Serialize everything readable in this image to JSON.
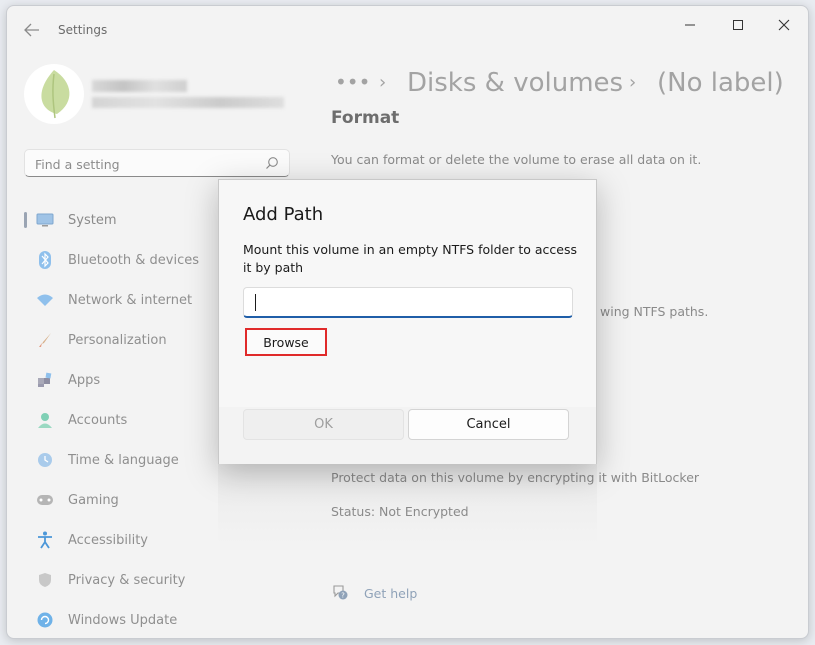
{
  "app": {
    "title": "Settings"
  },
  "search": {
    "placeholder": "Find a setting"
  },
  "sidebar": {
    "items": [
      {
        "label": "System",
        "icon": "monitor-icon"
      },
      {
        "label": "Bluetooth & devices",
        "icon": "bluetooth-icon"
      },
      {
        "label": "Network & internet",
        "icon": "wifi-icon"
      },
      {
        "label": "Personalization",
        "icon": "brush-icon"
      },
      {
        "label": "Apps",
        "icon": "apps-icon"
      },
      {
        "label": "Accounts",
        "icon": "person-icon"
      },
      {
        "label": "Time & language",
        "icon": "clock-globe-icon"
      },
      {
        "label": "Gaming",
        "icon": "gamepad-icon"
      },
      {
        "label": "Accessibility",
        "icon": "accessibility-icon"
      },
      {
        "label": "Privacy & security",
        "icon": "shield-icon"
      },
      {
        "label": "Windows Update",
        "icon": "update-icon"
      }
    ]
  },
  "breadcrumb": {
    "overflow": "•••",
    "parent": "Disks & volumes",
    "current": "(No label)"
  },
  "content": {
    "format_title": "Format",
    "format_desc": "You can format or delete the volume to erase all data on it.",
    "paths_fragment": "wing NTFS paths.",
    "bitlocker_desc": "Protect data on this volume by encrypting it with BitLocker",
    "status": "Status: Not Encrypted",
    "help": "Get help"
  },
  "dialog": {
    "title": "Add Path",
    "description": "Mount this volume in an empty NTFS folder to access it by path",
    "path_value": "",
    "browse_label": "Browse",
    "ok_label": "OK",
    "cancel_label": "Cancel"
  },
  "colors": {
    "accent": "#1f5ea8",
    "highlight": "#e02a2a"
  }
}
